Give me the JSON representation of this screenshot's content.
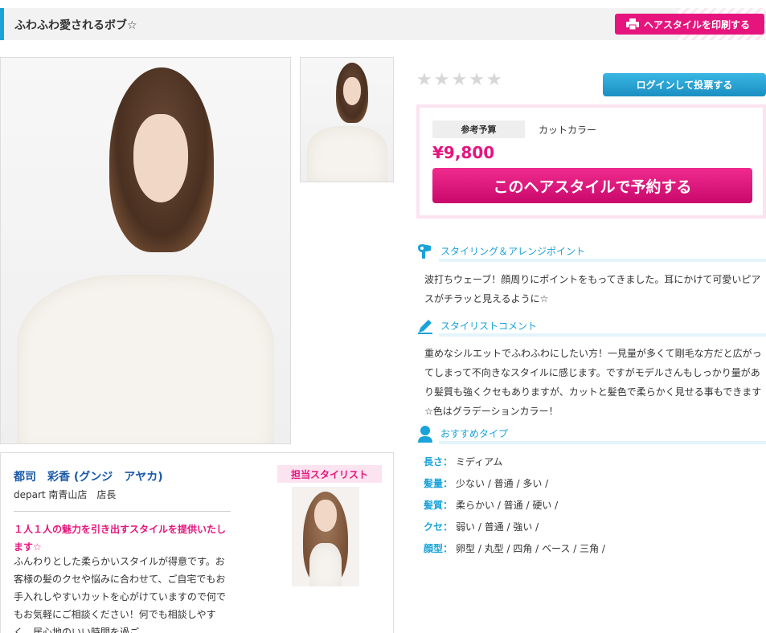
{
  "header": {
    "title": "ふわふわ愛されるボブ☆",
    "print_label": "ヘアスタイルを印刷する"
  },
  "rating": {
    "stars_filled": 0,
    "stars_total": 5
  },
  "login_button": "ログインして投票する",
  "price_box": {
    "budget_label": "参考予算",
    "menu": "カットカラー",
    "price": "¥9,800",
    "reserve_button": "このヘアスタイルで予約する"
  },
  "styling_point": {
    "title": "スタイリング＆アレンジポイント",
    "text": "波打ちウェーブ！顔周りにポイントをもってきました。耳にかけて可愛いピアスがチラッと見えるように☆"
  },
  "stylist_comment": {
    "title": "スタイリストコメント",
    "text": "重めなシルエットでふわふわにしたい方！一見量が多くて剛毛な方だと広がってしまって不向きなスタイルに感じます。ですがモデルさんもしっかり量があり髪質も強くクセもありますが、カットと髪色で柔らかく見せる事もできます☆色はグラデーションカラー！"
  },
  "recommend": {
    "title": "おすすめタイプ",
    "rows": [
      {
        "key": "長さ：",
        "value": "ミディアム"
      },
      {
        "key": "髪量：",
        "value": "少ない / 普通 / 多い /"
      },
      {
        "key": "髪質：",
        "value": "柔らかい / 普通 / 硬い /"
      },
      {
        "key": "クセ：",
        "value": "弱い / 普通 / 強い /"
      },
      {
        "key": "顔型：",
        "value": "卵型 / 丸型 / 四角 / ベース / 三角 /"
      }
    ]
  },
  "stylist": {
    "name": "都司　彩香 (グンジ　アヤカ)",
    "shop": "depart 南青山店　店長",
    "badge": "担当スタイリスト",
    "catch": "１人１人の魅力を引き出すスタイルを提供いたします☆",
    "desc": "ふんわりとした柔らかいスタイルが得意です。お客様の髪のクセや悩みに合わせて、ご自宅でもお手入れしやすいカットを心がけていますので何でもお気軽にご相談ください！何でも相談しやすく、居心地のいい時間を過ご"
  },
  "colors": {
    "accent_blue": "#1aa3d9",
    "accent_pink": "#e6157d"
  }
}
